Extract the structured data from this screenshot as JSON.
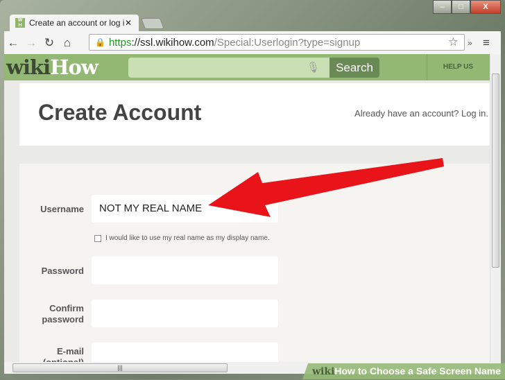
{
  "browser": {
    "tab_title": "Create an account or log i",
    "favicon": "wH",
    "url_scheme": "https",
    "url_host": "://ssl.wikihow.com",
    "url_path": "/Special:Userlogin?type=signup",
    "overflow": "»"
  },
  "header": {
    "logo_wiki": "wiki",
    "logo_how": "How",
    "search_placeholder": "",
    "search_button": "Search",
    "help_us": "HELP US"
  },
  "page": {
    "title": "Create Account",
    "login_link": "Already have an account? Log in."
  },
  "form": {
    "username_label": "Username",
    "username_value": "NOT MY REAL NAME",
    "realname_checkbox": "I would like to use my real name as my display name.",
    "realname_checked": false,
    "password_label": "Password",
    "confirm_label": "Confirm password",
    "email_label": "E-mail (optional)"
  },
  "annotation": {
    "arrow_color": "#e8141a"
  },
  "watermark": {
    "wiki": "wiki",
    "how": "How",
    "text": " to Choose a Safe Screen Name"
  }
}
